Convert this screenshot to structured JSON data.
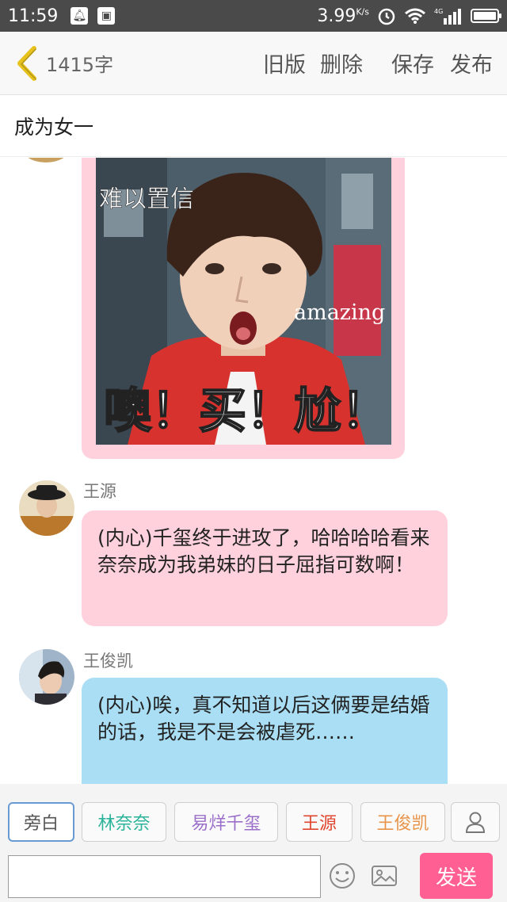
{
  "status_bar": {
    "time": "11:59",
    "speed": "3.99",
    "speed_unit": "K/s",
    "network": "4G"
  },
  "nav": {
    "word_count": "1415字",
    "actions": [
      "旧版",
      "删除",
      "保存",
      "发布"
    ]
  },
  "title": "成为女一",
  "meme": {
    "top_text": "难以置信",
    "side_text": "amazing",
    "bottom_text": "噢！买！尬！"
  },
  "messages": [
    {
      "name": "王源",
      "text": "(内心)千玺终于进攻了，哈哈哈哈看来奈奈成为我弟妹的日子屈指可数啊！",
      "bubble_color": "#ffd1dc"
    },
    {
      "name": "王俊凯",
      "text": "(内心)唉，真不知道以后这俩要是结婚的话，我是不是会被虐死……",
      "bubble_color": "#a9def5"
    }
  ],
  "roles": [
    {
      "label": "旁白",
      "color": "#555555"
    },
    {
      "label": "林奈奈",
      "color": "#2bb39a"
    },
    {
      "label": "易烊千玺",
      "color": "#9b6fc9"
    },
    {
      "label": "王源",
      "color": "#e0452f"
    },
    {
      "label": "王俊凯",
      "color": "#e8944a"
    }
  ],
  "input": {
    "placeholder": "",
    "send_label": "发送"
  },
  "colors": {
    "accent_send": "#ff5f92",
    "back_arrow": "#e8c21c",
    "pink_bubble": "#ffd1dc",
    "blue_bubble": "#a9def5"
  }
}
